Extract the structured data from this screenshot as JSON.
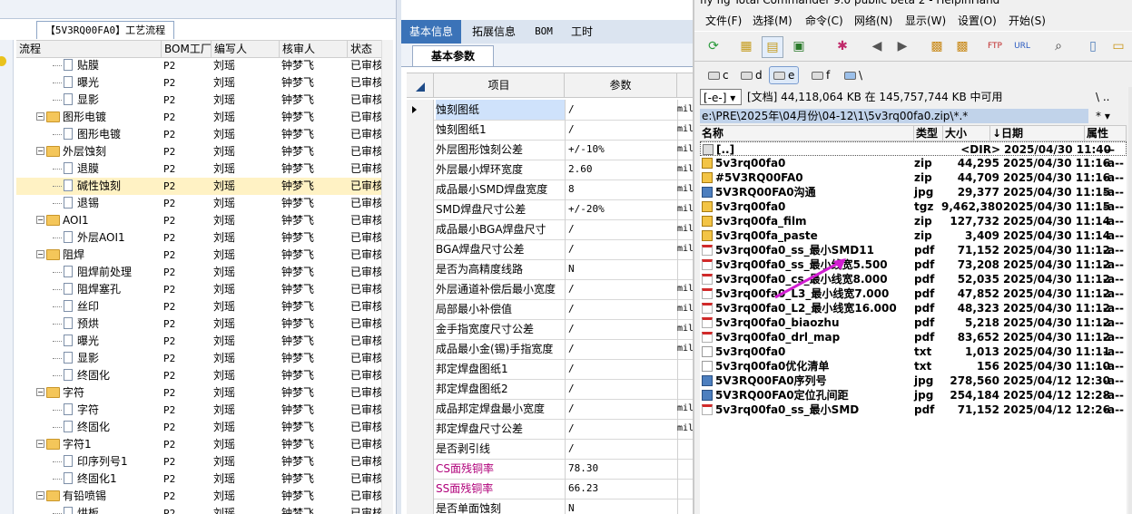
{
  "left": {
    "tab_label": "【5V3RQ00FA0】工艺流程",
    "columns": [
      "流程",
      "BOM工厂",
      "编写人",
      "核审人",
      "状态"
    ],
    "rows": [
      {
        "indent": 3,
        "kind": "doc",
        "name": "贴膜",
        "bom": "P2",
        "writer": "刘瑶",
        "reviewer": "钟梦飞",
        "status": "已审核"
      },
      {
        "indent": 3,
        "kind": "doc",
        "name": "曝光",
        "bom": "P2",
        "writer": "刘瑶",
        "reviewer": "钟梦飞",
        "status": "已审核"
      },
      {
        "indent": 3,
        "kind": "doc",
        "name": "显影",
        "bom": "P2",
        "writer": "刘瑶",
        "reviewer": "钟梦飞",
        "status": "已审核"
      },
      {
        "indent": 2,
        "kind": "folder",
        "name": "图形电镀",
        "bom": "P2",
        "writer": "刘瑶",
        "reviewer": "钟梦飞",
        "status": "已审核"
      },
      {
        "indent": 3,
        "kind": "doc",
        "name": "图形电镀",
        "bom": "P2",
        "writer": "刘瑶",
        "reviewer": "钟梦飞",
        "status": "已审核"
      },
      {
        "indent": 2,
        "kind": "folder",
        "name": "外层蚀刻",
        "bom": "P2",
        "writer": "刘瑶",
        "reviewer": "钟梦飞",
        "status": "已审核"
      },
      {
        "indent": 3,
        "kind": "doc",
        "name": "退膜",
        "bom": "P2",
        "writer": "刘瑶",
        "reviewer": "钟梦飞",
        "status": "已审核"
      },
      {
        "indent": 3,
        "kind": "doc",
        "name": "碱性蚀刻",
        "bom": "P2",
        "writer": "刘瑶",
        "reviewer": "钟梦飞",
        "status": "已审核",
        "selected": true
      },
      {
        "indent": 3,
        "kind": "doc",
        "name": "退锡",
        "bom": "P2",
        "writer": "刘瑶",
        "reviewer": "钟梦飞",
        "status": "已审核"
      },
      {
        "indent": 2,
        "kind": "folder",
        "name": "AOI1",
        "bom": "P2",
        "writer": "刘瑶",
        "reviewer": "钟梦飞",
        "status": "已审核"
      },
      {
        "indent": 3,
        "kind": "doc",
        "name": "外层AOI1",
        "bom": "P2",
        "writer": "刘瑶",
        "reviewer": "钟梦飞",
        "status": "已审核"
      },
      {
        "indent": 2,
        "kind": "folder",
        "name": "阻焊",
        "bom": "P2",
        "writer": "刘瑶",
        "reviewer": "钟梦飞",
        "status": "已审核"
      },
      {
        "indent": 3,
        "kind": "doc",
        "name": "阻焊前处理",
        "bom": "P2",
        "writer": "刘瑶",
        "reviewer": "钟梦飞",
        "status": "已审核"
      },
      {
        "indent": 3,
        "kind": "doc",
        "name": "阻焊塞孔",
        "bom": "P2",
        "writer": "刘瑶",
        "reviewer": "钟梦飞",
        "status": "已审核"
      },
      {
        "indent": 3,
        "kind": "doc",
        "name": "丝印",
        "bom": "P2",
        "writer": "刘瑶",
        "reviewer": "钟梦飞",
        "status": "已审核"
      },
      {
        "indent": 3,
        "kind": "doc",
        "name": "预烘",
        "bom": "P2",
        "writer": "刘瑶",
        "reviewer": "钟梦飞",
        "status": "已审核"
      },
      {
        "indent": 3,
        "kind": "doc",
        "name": "曝光",
        "bom": "P2",
        "writer": "刘瑶",
        "reviewer": "钟梦飞",
        "status": "已审核"
      },
      {
        "indent": 3,
        "kind": "doc",
        "name": "显影",
        "bom": "P2",
        "writer": "刘瑶",
        "reviewer": "钟梦飞",
        "status": "已审核"
      },
      {
        "indent": 3,
        "kind": "doc",
        "name": "终固化",
        "bom": "P2",
        "writer": "刘瑶",
        "reviewer": "钟梦飞",
        "status": "已审核"
      },
      {
        "indent": 2,
        "kind": "folder",
        "name": "字符",
        "bom": "P2",
        "writer": "刘瑶",
        "reviewer": "钟梦飞",
        "status": "已审核"
      },
      {
        "indent": 3,
        "kind": "doc",
        "name": "字符",
        "bom": "P2",
        "writer": "刘瑶",
        "reviewer": "钟梦飞",
        "status": "已审核"
      },
      {
        "indent": 3,
        "kind": "doc",
        "name": "终固化",
        "bom": "P2",
        "writer": "刘瑶",
        "reviewer": "钟梦飞",
        "status": "已审核"
      },
      {
        "indent": 2,
        "kind": "folder",
        "name": "字符1",
        "bom": "P2",
        "writer": "刘瑶",
        "reviewer": "钟梦飞",
        "status": "已审核"
      },
      {
        "indent": 3,
        "kind": "doc",
        "name": "印序列号1",
        "bom": "P2",
        "writer": "刘瑶",
        "reviewer": "钟梦飞",
        "status": "已审核"
      },
      {
        "indent": 3,
        "kind": "doc",
        "name": "终固化1",
        "bom": "P2",
        "writer": "刘瑶",
        "reviewer": "钟梦飞",
        "status": "已审核"
      },
      {
        "indent": 2,
        "kind": "folder",
        "name": "有铅喷锡",
        "bom": "P2",
        "writer": "刘瑶",
        "reviewer": "钟梦飞",
        "status": "已审核"
      },
      {
        "indent": 3,
        "kind": "doc",
        "name": "烘板",
        "bom": "P2",
        "writer": "刘瑶",
        "reviewer": "钟梦飞",
        "status": "已审核"
      }
    ]
  },
  "mid": {
    "tabs": [
      "基本信息",
      "拓展信息",
      "BOM",
      "工时"
    ],
    "active_tab": 0,
    "sub_tab": "基本参数",
    "columns": [
      "项目",
      "参数"
    ],
    "rows": [
      {
        "item": "蚀刻图纸",
        "param": "/",
        "unit": "mil",
        "selected": true
      },
      {
        "item": "蚀刻图纸1",
        "param": "/",
        "unit": "mil"
      },
      {
        "item": "外层图形蚀刻公差",
        "param": "+/-10%",
        "unit": "mil"
      },
      {
        "item": "外层最小焊环宽度",
        "param": "2.60",
        "unit": "mil"
      },
      {
        "item": "成品最小SMD焊盘宽度",
        "param": "8",
        "unit": "mil"
      },
      {
        "item": "SMD焊盘尺寸公差",
        "param": "+/-20%",
        "unit": "mil"
      },
      {
        "item": "成品最小BGA焊盘尺寸",
        "param": "/",
        "unit": "mil"
      },
      {
        "item": "BGA焊盘尺寸公差",
        "param": "/",
        "unit": "mil"
      },
      {
        "item": "是否为高精度线路",
        "param": "N",
        "unit": ""
      },
      {
        "item": "外层通道补偿后最小宽度",
        "param": "/",
        "unit": "mil"
      },
      {
        "item": "局部最小补偿值",
        "param": "/",
        "unit": "mil"
      },
      {
        "item": "金手指宽度尺寸公差",
        "param": "/",
        "unit": "mil"
      },
      {
        "item": "成品最小金(锡)手指宽度",
        "param": "/",
        "unit": "mil"
      },
      {
        "item": "邦定焊盘图纸1",
        "param": "/",
        "unit": ""
      },
      {
        "item": "邦定焊盘图纸2",
        "param": "/",
        "unit": ""
      },
      {
        "item": "成品邦定焊盘最小宽度",
        "param": "/",
        "unit": "mil"
      },
      {
        "item": "邦定焊盘尺寸公差",
        "param": "/",
        "unit": "mil"
      },
      {
        "item": "是否剥引线",
        "param": "/",
        "unit": ""
      },
      {
        "item": "CS面残铜率",
        "param": "78.30",
        "unit": "",
        "magenta": true
      },
      {
        "item": "SS面残铜率",
        "param": "66.23",
        "unit": "",
        "magenta": true
      },
      {
        "item": "是否单面蚀刻",
        "param": "N",
        "unit": ""
      }
    ]
  },
  "tc": {
    "title": "fly fig      Total Commander 9.0 public beta 2 - HelpinHand",
    "menu": [
      "文件(F)",
      "选择(M)",
      "命令(C)",
      "网络(N)",
      "显示(W)",
      "设置(O)",
      "开始(S)"
    ],
    "drives": [
      "c",
      "d",
      "e",
      "f",
      "\\"
    ],
    "active_drive": 2,
    "drive_select": "[-e-] ▾",
    "free_space": "[文档]  44,118,064 KB 在 145,757,744 KB 中可用",
    "nav_buttons": "\\  ..",
    "path": "e:\\PRE\\2025年\\04月份\\04-12\\1\\5v3rq00fa0.zip\\*.*",
    "filter": "*  ▾",
    "columns": [
      "名称",
      "类型",
      "大小",
      "↓日期",
      "属性"
    ],
    "files": [
      {
        "icon": "up",
        "name": "[..]",
        "type": "",
        "size": "<DIR>",
        "date": "2025/04/30 11:40",
        "attr": "—"
      },
      {
        "icon": "zip",
        "name": "5v3rq00fa0",
        "type": "zip",
        "size": "44,295",
        "date": "2025/04/30 11:16",
        "attr": "-a--"
      },
      {
        "icon": "zip",
        "name": "#5V3RQ00FA0",
        "type": "zip",
        "size": "44,709",
        "date": "2025/04/30 11:16",
        "attr": "-a--"
      },
      {
        "icon": "jpg",
        "name": "5V3RQ00FA0沟通",
        "type": "jpg",
        "size": "29,377",
        "date": "2025/04/30 11:15",
        "attr": "-a--"
      },
      {
        "icon": "zip",
        "name": "5v3rq00fa0",
        "type": "tgz",
        "size": "9,462,380",
        "date": "2025/04/30 11:15",
        "attr": "-a--"
      },
      {
        "icon": "zip",
        "name": "5v3rq00fa_film",
        "type": "zip",
        "size": "127,732",
        "date": "2025/04/30 11:14",
        "attr": "-a--"
      },
      {
        "icon": "zip",
        "name": "5v3rq00fa_paste",
        "type": "zip",
        "size": "3,409",
        "date": "2025/04/30 11:14",
        "attr": "-a--"
      },
      {
        "icon": "pdf",
        "name": "5v3rq00fa0_ss_最小SMD11",
        "type": "pdf",
        "size": "71,152",
        "date": "2025/04/30 11:12",
        "attr": "-a--"
      },
      {
        "icon": "pdf",
        "name": "5v3rq00fa0_ss_最小线宽5.500",
        "type": "pdf",
        "size": "73,208",
        "date": "2025/04/30 11:12",
        "attr": "-a--"
      },
      {
        "icon": "pdf",
        "name": "5v3rq00fa0_cs_最小线宽8.000",
        "type": "pdf",
        "size": "52,035",
        "date": "2025/04/30 11:12",
        "attr": "-a--"
      },
      {
        "icon": "pdf",
        "name": "5v3rq00fa0_L3_最小线宽7.000",
        "type": "pdf",
        "size": "47,852",
        "date": "2025/04/30 11:12",
        "attr": "-a--"
      },
      {
        "icon": "pdf",
        "name": "5v3rq00fa0_L2_最小线宽16.000",
        "type": "pdf",
        "size": "48,323",
        "date": "2025/04/30 11:12",
        "attr": "-a--"
      },
      {
        "icon": "pdf",
        "name": "5v3rq00fa0_biaozhu",
        "type": "pdf",
        "size": "5,218",
        "date": "2025/04/30 11:12",
        "attr": "-a--"
      },
      {
        "icon": "pdf",
        "name": "5v3rq00fa0_drl_map",
        "type": "pdf",
        "size": "83,652",
        "date": "2025/04/30 11:12",
        "attr": "-a--"
      },
      {
        "icon": "txt",
        "name": "5v3rq00fa0",
        "type": "txt",
        "size": "1,013",
        "date": "2025/04/30 11:11",
        "attr": "-a--"
      },
      {
        "icon": "txt",
        "name": "5v3rq00fa0优化清单",
        "type": "txt",
        "size": "156",
        "date": "2025/04/30 11:10",
        "attr": "-a--"
      },
      {
        "icon": "jpg",
        "name": "5V3RQ00FA0序列号",
        "type": "jpg",
        "size": "278,560",
        "date": "2025/04/12 12:30",
        "attr": "-a--"
      },
      {
        "icon": "jpg",
        "name": "5V3RQ00FA0定位孔间距",
        "type": "jpg",
        "size": "254,184",
        "date": "2025/04/12 12:28",
        "attr": "-a--"
      },
      {
        "icon": "pdf",
        "name": "5v3rq00fa0_ss_最小SMD",
        "type": "pdf",
        "size": "71,152",
        "date": "2025/04/12 12:26",
        "attr": "-a--"
      }
    ]
  },
  "colors": {
    "accent": "#3b73b8",
    "selected_row": "#ffdf80",
    "path_bar": "#c1d3ea",
    "arrow": "#d11fd1",
    "magenta_text": "#b0007a"
  }
}
